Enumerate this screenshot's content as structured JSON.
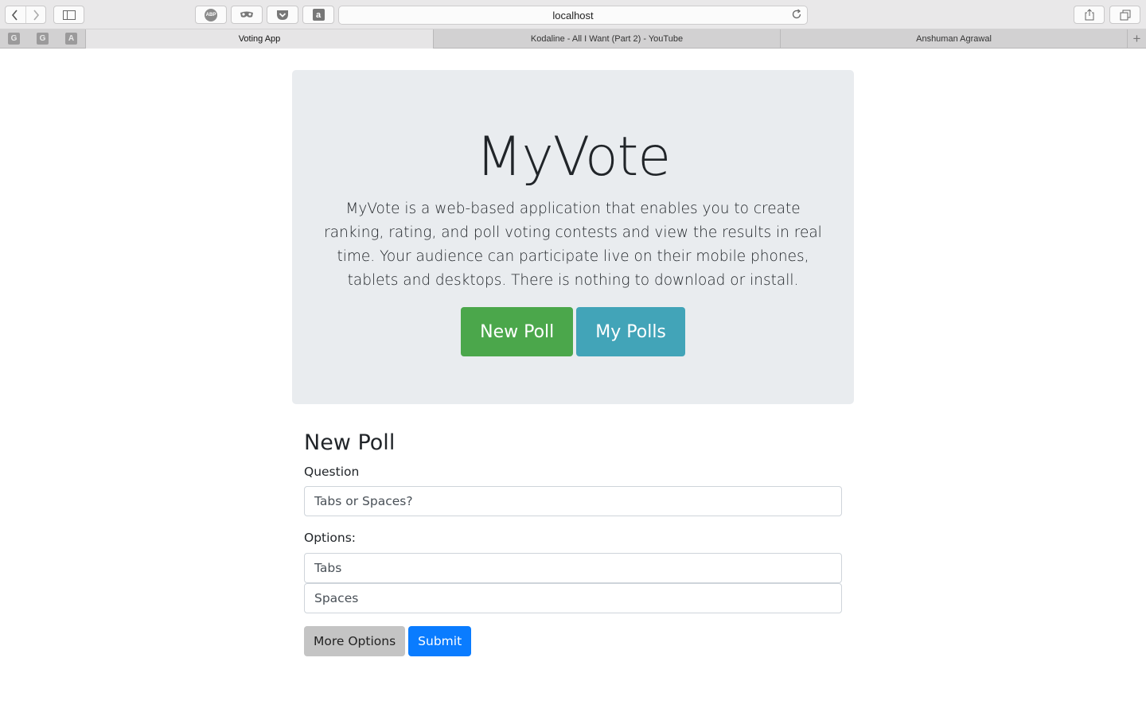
{
  "browser": {
    "url": "localhost",
    "pinned_tabs": [
      "G",
      "G",
      "A"
    ],
    "tabs": [
      {
        "label": "Voting App",
        "active": true
      },
      {
        "label": "Kodaline - All I Want (Part 2) - YouTube",
        "active": false
      },
      {
        "label": "Anshuman Agrawal",
        "active": false
      }
    ],
    "extensions": [
      "ABP"
    ]
  },
  "hero": {
    "title": "MyVote",
    "description": "MyVote is a web-based application that enables you to create ranking, rating, and poll voting contests and view the results in real time. Your audience can participate live on their mobile phones, tablets and desktops. There is nothing to download or install.",
    "new_poll_label": "New Poll",
    "my_polls_label": "My Polls"
  },
  "form": {
    "heading": "New Poll",
    "question_label": "Question",
    "question_value": "Tabs or Spaces?",
    "options_label": "Options:",
    "options": [
      "Tabs",
      "Spaces"
    ],
    "more_options_label": "More Options",
    "submit_label": "Submit"
  },
  "colors": {
    "green": "#4ba74b",
    "teal": "#42a4b8",
    "blue": "#0a7cff",
    "jumbotron_bg": "#e9ecef"
  }
}
